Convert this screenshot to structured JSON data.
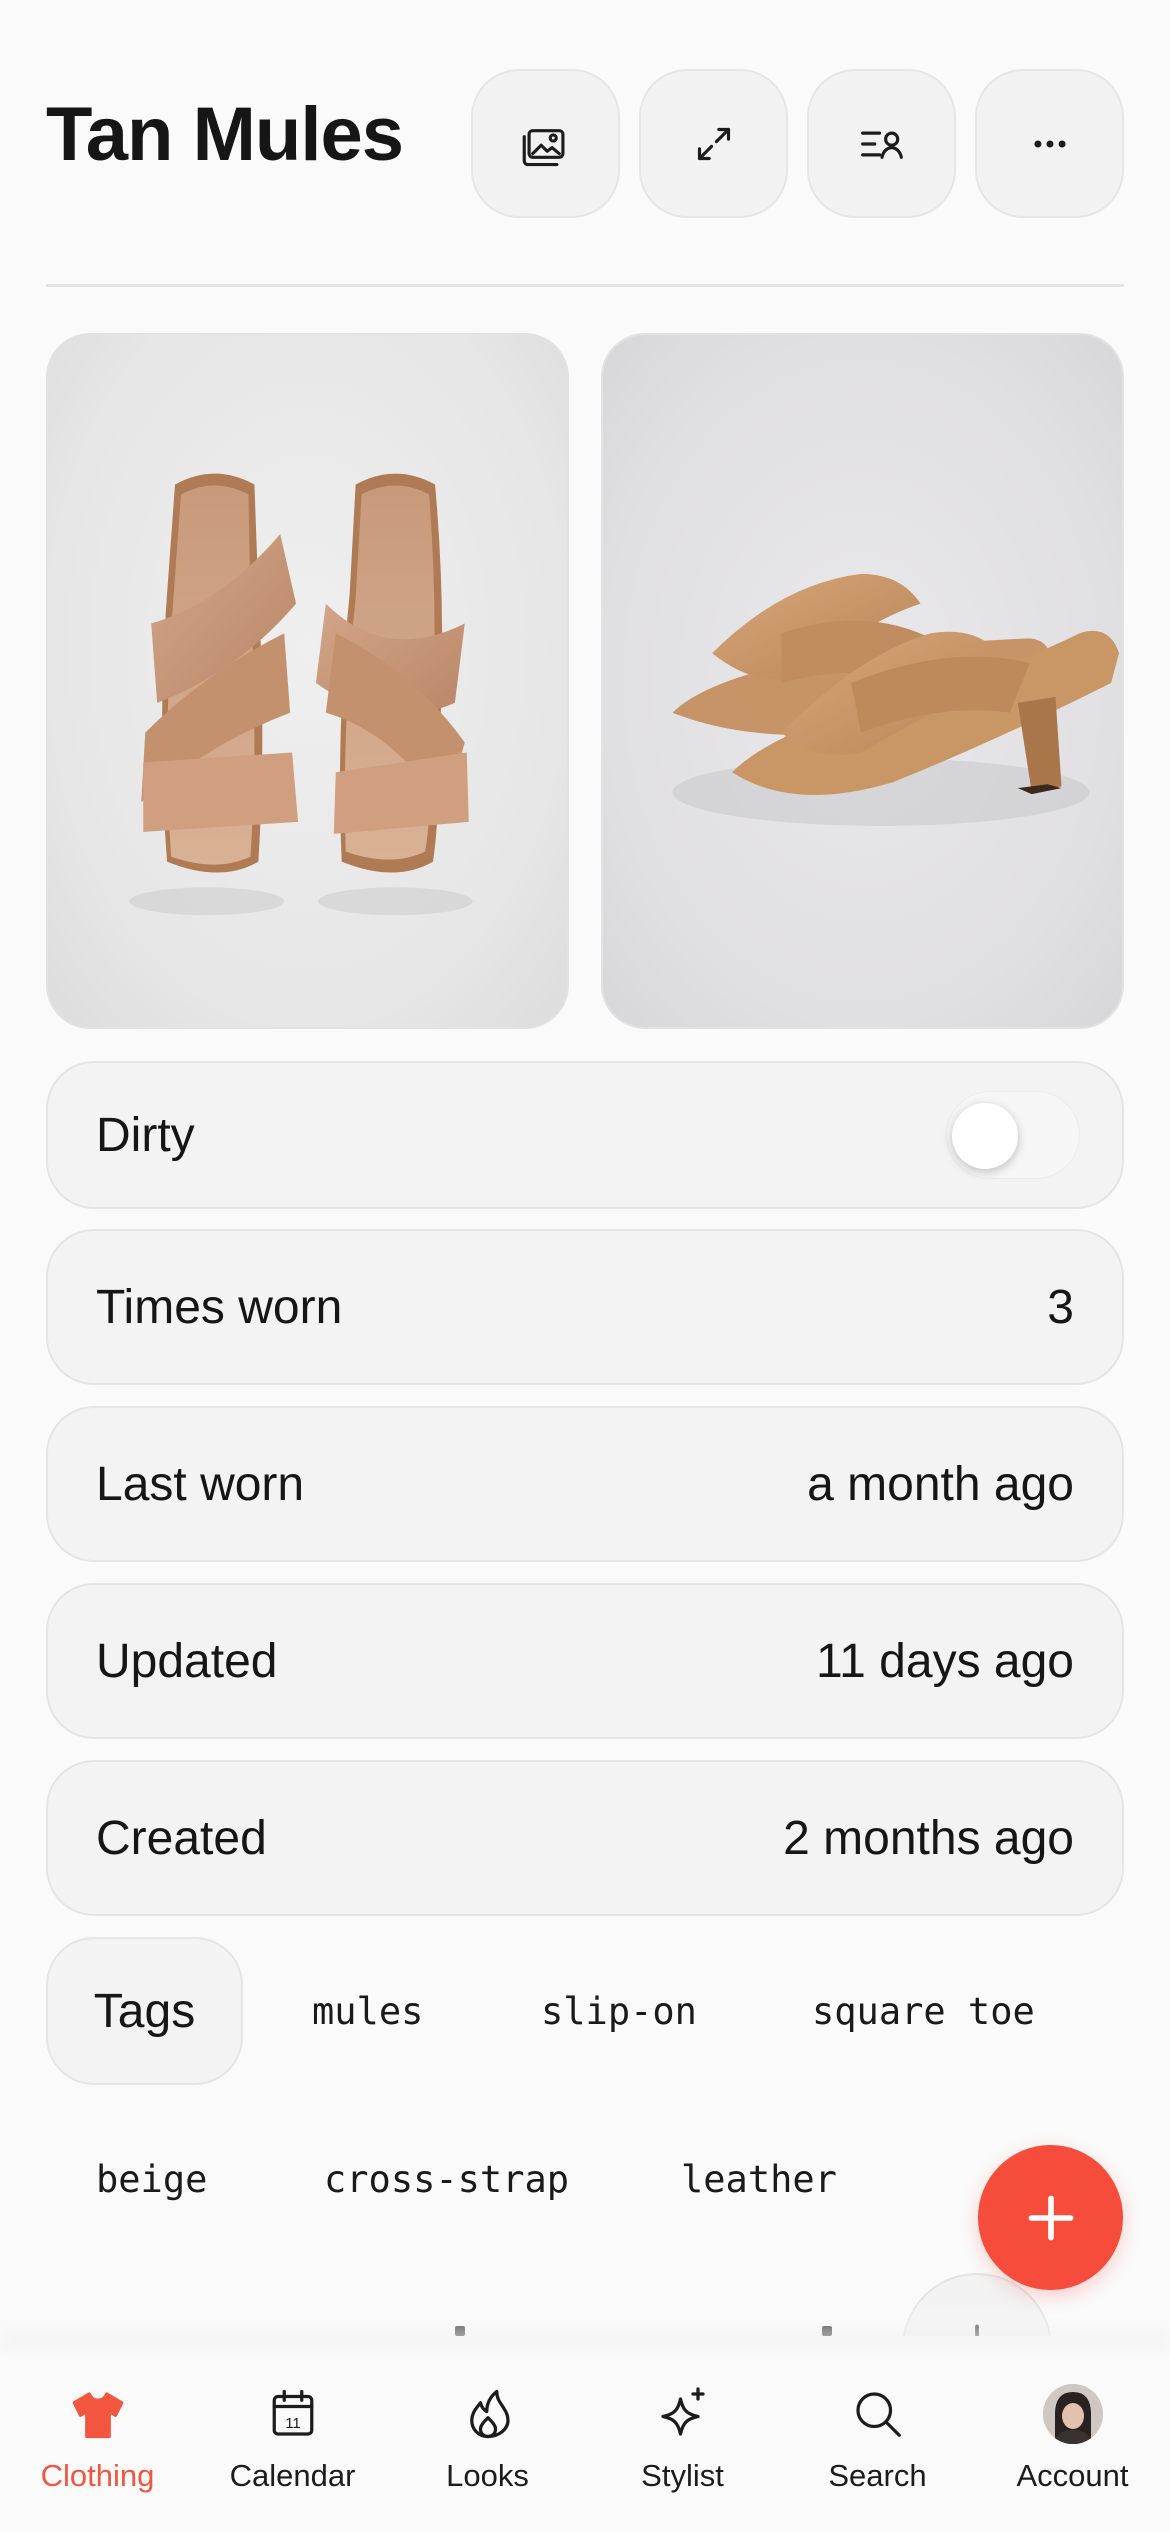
{
  "header": {
    "title": "Tan Mules",
    "buttons": [
      {
        "name": "gallery-icon"
      },
      {
        "name": "expand-icon"
      },
      {
        "name": "assign-person-icon"
      },
      {
        "name": "more-icon"
      }
    ]
  },
  "details": {
    "dirty": {
      "label": "Dirty",
      "on": false
    },
    "times_worn": {
      "label": "Times worn",
      "value": "3"
    },
    "last_worn": {
      "label": "Last worn",
      "value": "a month ago"
    },
    "updated": {
      "label": "Updated",
      "value": "11 days ago"
    },
    "created": {
      "label": "Created",
      "value": "2 months ago"
    }
  },
  "tags": {
    "label": "Tags",
    "items": [
      "mules",
      "slip-on",
      "square toe",
      "beige",
      "cross-strap",
      "leather"
    ]
  },
  "tabbar": {
    "items": [
      {
        "label": "Clothing",
        "icon": "tshirt-icon",
        "active": true
      },
      {
        "label": "Calendar",
        "icon": "calendar-icon",
        "day": "11"
      },
      {
        "label": "Looks",
        "icon": "flame-icon"
      },
      {
        "label": "Stylist",
        "icon": "sparkle-icon"
      },
      {
        "label": "Search",
        "icon": "search-icon"
      },
      {
        "label": "Account",
        "icon": "avatar"
      }
    ]
  },
  "colors": {
    "accent": "#f64c3b",
    "active_tab": "#f2563f",
    "background": "#fafafa",
    "card": "#f3f3f3"
  }
}
